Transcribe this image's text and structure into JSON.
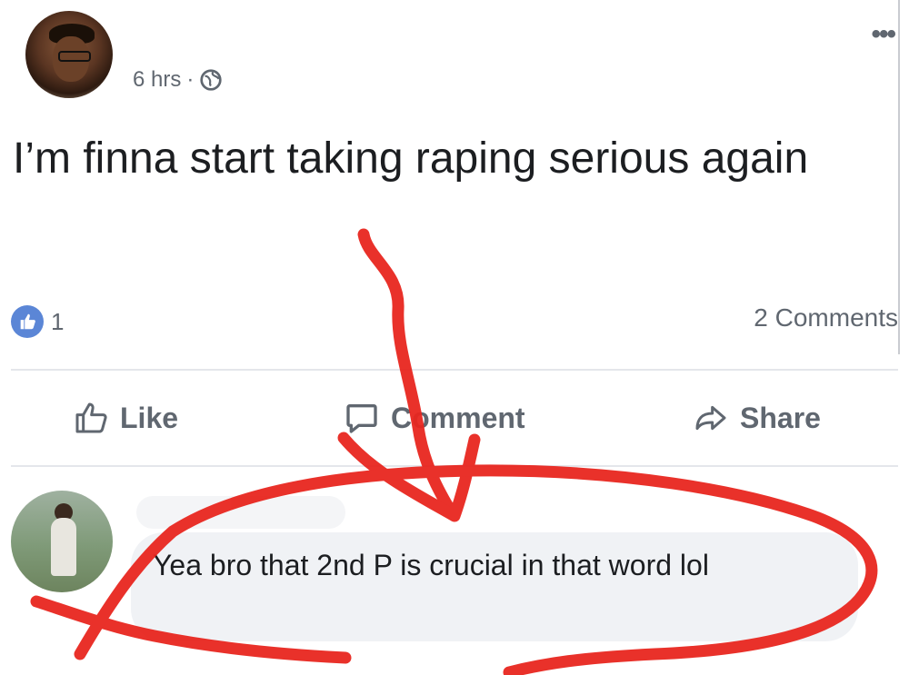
{
  "post": {
    "timestamp": "6 hrs",
    "separator": "·",
    "privacy_icon": "globe-icon",
    "text": "I’m finna start taking raping serious again",
    "reaction_count": "1",
    "comments_count": "2 Comments"
  },
  "actions": {
    "like": "Like",
    "comment": "Comment",
    "share": "Share"
  },
  "comment": {
    "text": "Yea bro that 2nd P is crucial in that word lol"
  },
  "colors": {
    "like_blue": "#5b86d6",
    "muted_text": "#606770",
    "annotation_red": "#e8261f",
    "bubble_bg": "#f0f2f5"
  }
}
